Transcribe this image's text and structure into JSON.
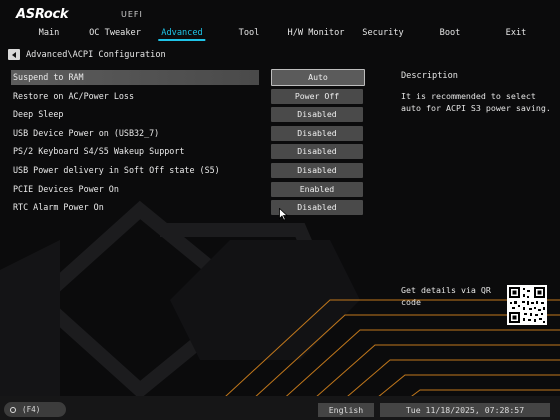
{
  "header": {
    "logo": "ASRock",
    "subtitle": "UEFI",
    "tabs": [
      {
        "label": "Main",
        "active": false
      },
      {
        "label": "OC Tweaker",
        "active": false
      },
      {
        "label": "Advanced",
        "active": true
      },
      {
        "label": "Tool",
        "active": false
      },
      {
        "label": "H/W Monitor",
        "active": false
      },
      {
        "label": "Security",
        "active": false
      },
      {
        "label": "Boot",
        "active": false
      },
      {
        "label": "Exit",
        "active": false
      }
    ]
  },
  "breadcrumb": "Advanced\\ACPI Configuration",
  "settings": [
    {
      "label": "Suspend to RAM",
      "value": "Auto",
      "selected": true
    },
    {
      "label": "Restore on AC/Power Loss",
      "value": "Power Off"
    },
    {
      "label": "Deep Sleep",
      "value": "Disabled"
    },
    {
      "label": "USB Device Power on (USB32_7)",
      "value": "Disabled"
    },
    {
      "label": "PS/2 Keyboard S4/S5 Wakeup Support",
      "value": "Disabled"
    },
    {
      "label": "USB Power delivery in Soft Off state (S5)",
      "value": "Disabled"
    },
    {
      "label": "PCIE Devices Power On",
      "value": "Enabled"
    },
    {
      "label": "RTC Alarm Power On",
      "value": "Disabled"
    }
  ],
  "description": {
    "title": "Description",
    "text": "It is recommended to select auto for ACPI S3 power saving."
  },
  "qr": {
    "text": "Get details via QR code"
  },
  "footer": {
    "f4_label": "(F4)",
    "language": "English",
    "datetime": "Tue 11/18/2025, 07:28:57"
  },
  "colors": {
    "accent": "#1fc4e8",
    "deco_orange": "#e08a1e"
  }
}
